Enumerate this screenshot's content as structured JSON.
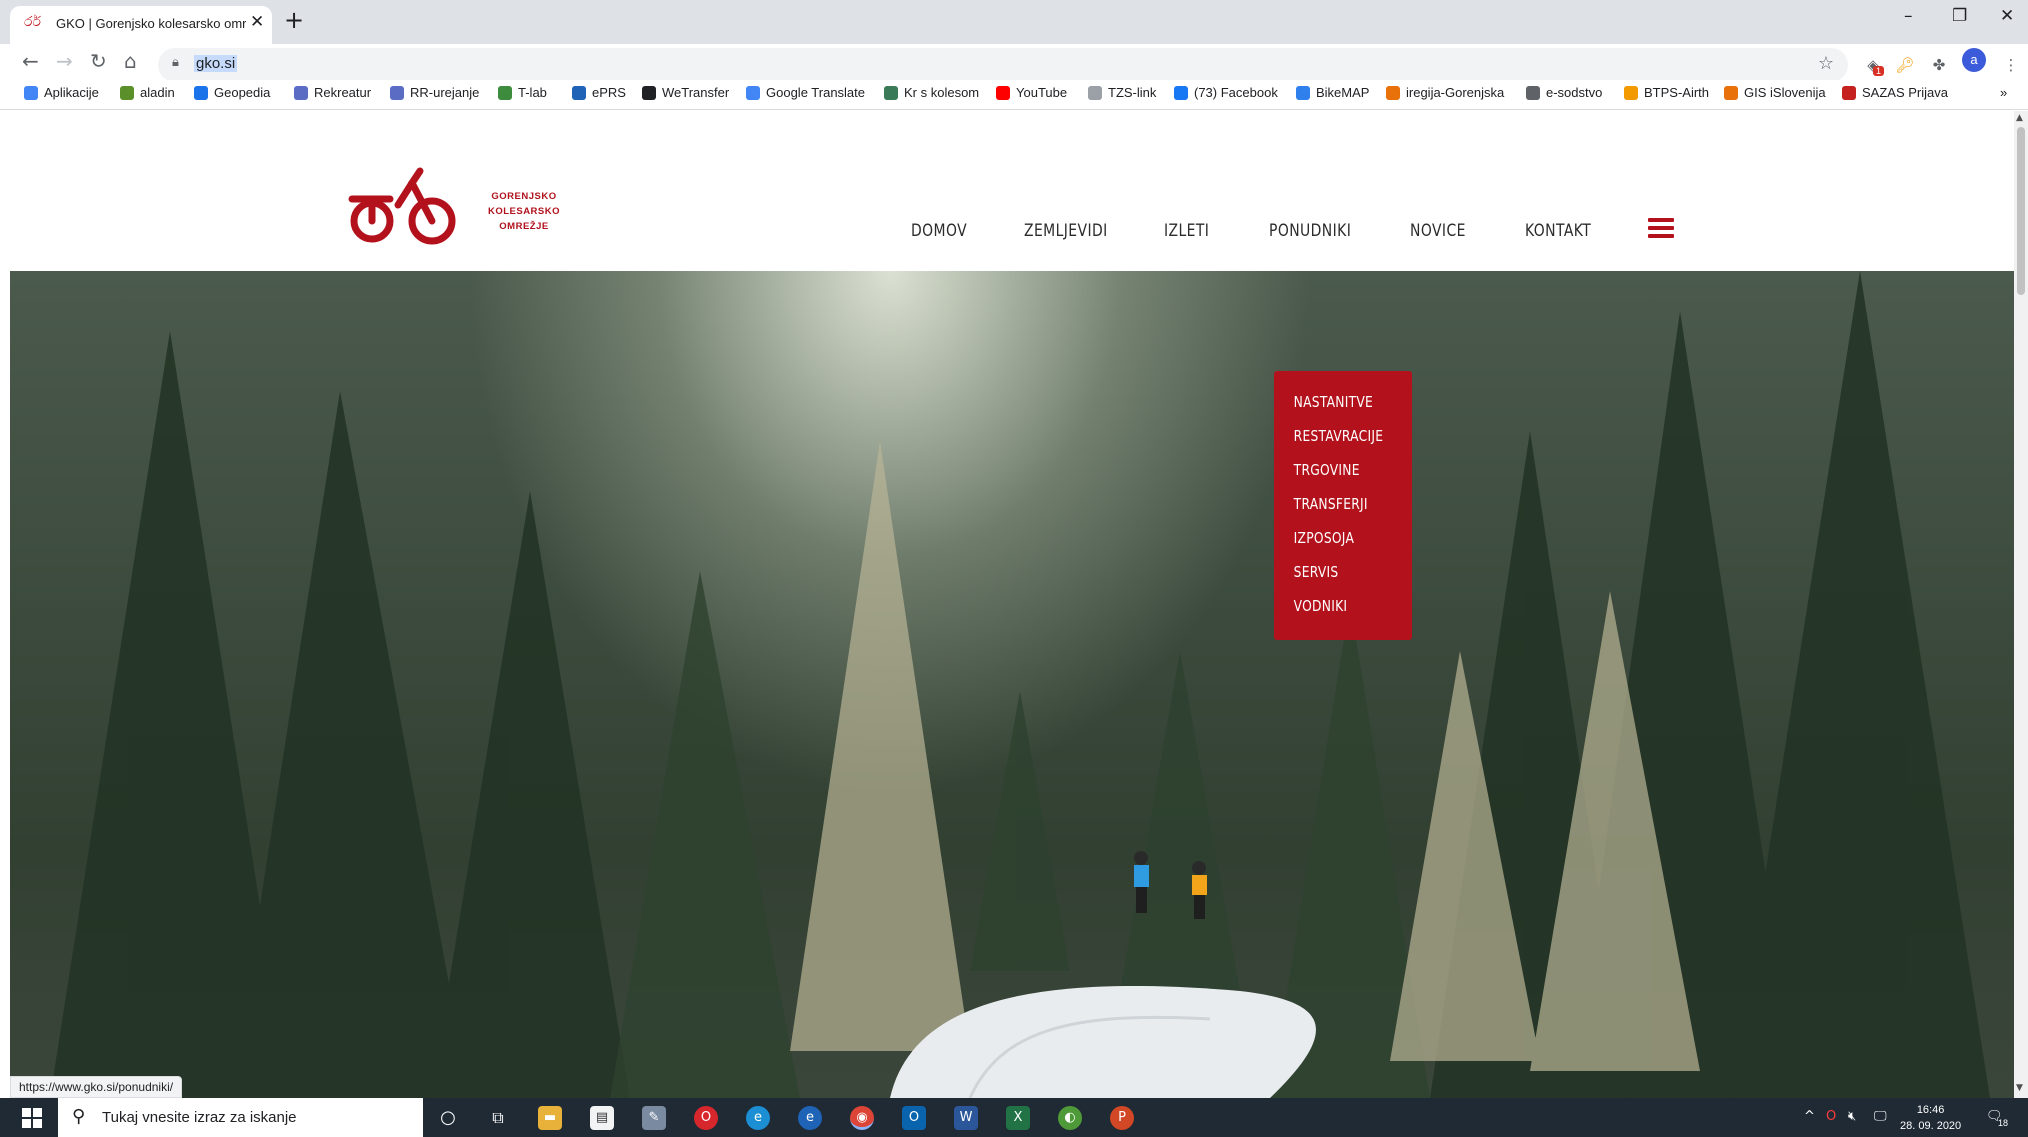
{
  "browser": {
    "tab_title": "GKO | Gorenjsko kolesarsko omrežje",
    "new_tab": "+",
    "url": "gko.si",
    "status_url": "https://www.gko.si/ponudniki/",
    "profile_initial": "a",
    "extension_badge": "1"
  },
  "bookmarks": [
    {
      "label": "Aplikacije",
      "icon": "apps-grid-icon",
      "color": "#4285f4"
    },
    {
      "label": "aladin",
      "icon": "aladin-icon",
      "color": "#5a8f29"
    },
    {
      "label": "Geopedia",
      "icon": "geopedia-icon",
      "color": "#1a73e8"
    },
    {
      "label": "Rekreatur",
      "icon": "rekreatur-icon",
      "color": "#5b6cc4"
    },
    {
      "label": "RR-urejanje",
      "icon": "rr-icon",
      "color": "#5b6cc4"
    },
    {
      "label": "T-lab",
      "icon": "tlab-icon",
      "color": "#3d8b3d"
    },
    {
      "label": "ePRS",
      "icon": "eprs-icon",
      "color": "#1e63b5"
    },
    {
      "label": "WeTransfer",
      "icon": "wetransfer-icon",
      "color": "#202124"
    },
    {
      "label": "Google Translate",
      "icon": "translate-icon",
      "color": "#4285f4"
    },
    {
      "label": "Kr s kolesom",
      "icon": "bike-icon",
      "color": "#3b7a57"
    },
    {
      "label": "YouTube",
      "icon": "youtube-icon",
      "color": "#ff0000"
    },
    {
      "label": "TZS-link",
      "icon": "document-icon",
      "color": "#9aa0a6"
    },
    {
      "label": "(73) Facebook",
      "icon": "facebook-icon",
      "color": "#1877f2"
    },
    {
      "label": "BikeMAP",
      "icon": "bikemap-icon",
      "color": "#2f80ed"
    },
    {
      "label": "iregija-Gorenjska",
      "icon": "iregija-icon",
      "color": "#e8710a"
    },
    {
      "label": "e-sodstvo",
      "icon": "scales-icon",
      "color": "#5f6368"
    },
    {
      "label": "BTPS-Airth",
      "icon": "btps-icon",
      "color": "#f29900"
    },
    {
      "label": "GIS iSlovenija",
      "icon": "gis-icon",
      "color": "#e8710a"
    },
    {
      "label": "SAZAS Prijava",
      "icon": "sazas-icon",
      "color": "#c5221f"
    }
  ],
  "site": {
    "logo_line1": "GORENJSKO",
    "logo_line2": "KOLESARSKO",
    "logo_line3": "OMREŽJE",
    "brand_color": "#b3121c",
    "nav": [
      "DOMOV",
      "ZEMLJEVIDI",
      "IZLETI",
      "PONUDNIKI",
      "NOVICE",
      "KONTAKT"
    ],
    "dropdown": [
      "NASTANITVE",
      "RESTAVRACIJE",
      "TRGOVINE",
      "TRANSFERJI",
      "IZPOSOJA",
      "SERVIS",
      "VODNIKI"
    ]
  },
  "taskbar": {
    "search_placeholder": "Tukaj vnesite izraz za iskanje",
    "time": "16:46",
    "date": "28. 09. 2020",
    "notifications": "18"
  }
}
